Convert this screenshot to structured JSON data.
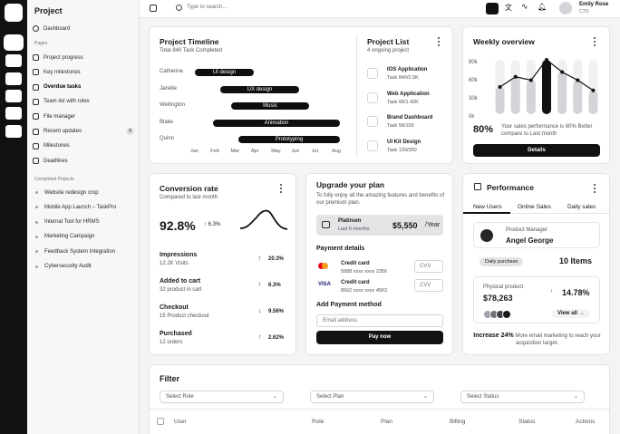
{
  "sidebar": {
    "title": "Project",
    "dashboard": "Dashboard",
    "pages_label": "Pages",
    "items": [
      {
        "label": "Project progress",
        "bold": false
      },
      {
        "label": "Key milestones",
        "bold": false
      },
      {
        "label": "Overdue tasks",
        "bold": true
      },
      {
        "label": "Team list with roles",
        "bold": false
      },
      {
        "label": "File manager",
        "bold": false
      },
      {
        "label": "Recent updates",
        "bold": false,
        "badge": "8"
      },
      {
        "label": "Milestones",
        "bold": false
      },
      {
        "label": "Deadlines",
        "bold": false
      }
    ],
    "completed_label": "Completed Projects",
    "completed": [
      "Website redesign crop",
      "Mobile App Launch – TaskPro",
      "Internal Tool for HRMS",
      "Marketing Campaign",
      "Feedback System Integration",
      "Cybersecurity Audit"
    ]
  },
  "topbar": {
    "search_placeholder": "Type to search...",
    "user_name": "Emily Rose",
    "user_role": "CTO"
  },
  "timeline": {
    "title": "Project Timeline",
    "subtitle": "Total 840 Task Completed",
    "rows": [
      {
        "name": "Catherine",
        "task": "UI design"
      },
      {
        "name": "Janelle",
        "task": "UX design"
      },
      {
        "name": "Wellington",
        "task": "Music"
      },
      {
        "name": "Blake",
        "task": "Animation"
      },
      {
        "name": "Quinn",
        "task": "Prototyping"
      }
    ],
    "months": [
      "Jan",
      "Feb",
      "Mar",
      "Apr",
      "May",
      "Jun",
      "Jul",
      "Aug"
    ]
  },
  "project_list": {
    "title": "Project List",
    "subtitle": "4 ongoing project",
    "items": [
      {
        "name": "IOS Application",
        "task": "Task 840/2.5K"
      },
      {
        "name": "Web Application",
        "task": "Task 99/1.42K"
      },
      {
        "name": "Brand Dashboard",
        "task": "Task 58/100"
      },
      {
        "name": "UI Kit Design",
        "task": "Task 120/350"
      }
    ]
  },
  "weekly": {
    "title": "Weekly overview",
    "ylabels": [
      "80k",
      "60k",
      "30k",
      "0k"
    ],
    "percent": "80%",
    "note": "Your sales performance is 60% Better compare to Last month",
    "button": "Details"
  },
  "chart_data": {
    "type": "bar",
    "values": [
      40,
      55,
      50,
      80,
      62,
      50,
      35
    ],
    "line": [
      40,
      55,
      50,
      80,
      62,
      50,
      35
    ],
    "ylim": [
      0,
      80
    ],
    "yticks": [
      "80k",
      "60k",
      "30k",
      "0k"
    ]
  },
  "conversion": {
    "title": "Conversion rate",
    "subtitle": "Compared to last month",
    "value": "92.8%",
    "change": "6.3%",
    "metrics": [
      {
        "label": "Impressions",
        "sub": "12.2K Visits",
        "value": "20.3%",
        "dir": "up"
      },
      {
        "label": "Added to cart",
        "sub": "32 product in cart",
        "value": "6.3%",
        "dir": "up"
      },
      {
        "label": "Checkout",
        "sub": "15 Product checkout",
        "value": "9.56%",
        "dir": "down"
      },
      {
        "label": "Purchased",
        "sub": "12 orders",
        "value": "2.62%",
        "dir": "up"
      }
    ]
  },
  "upgrade": {
    "title": "Upgrade your plan",
    "subtitle": "To fully enjoy all the amazing features and benefits of our premium plan.",
    "plan_name": "Platinum",
    "plan_period": "Last 6 months",
    "price": "$5,550",
    "price_unit": "/Year",
    "payment_details": "Payment details",
    "cards": [
      {
        "name": "Credit card",
        "number": "5888 xxxx xxxx 2356",
        "brand": "mc"
      },
      {
        "name": "Credit card",
        "number": "8562 xxxx xxxx 4563",
        "brand": "VISA"
      }
    ],
    "cvv_placeholder": "CVV",
    "add_method": "Add Payment method",
    "email_placeholder": "Email address",
    "button": "Pay now"
  },
  "performance": {
    "title": "Performance",
    "tabs": [
      "New Users",
      "Online Sales",
      "Daily sales"
    ],
    "manager_role": "Product Manager",
    "manager_name": "Angel George",
    "daily_label": "Daily purchase",
    "daily_value": "10 Items",
    "physical_label": "Physical product",
    "physical_value": "$78,263",
    "physical_change": "14.78%",
    "view_all": "View all",
    "increase_bold": "Increase 24%",
    "increase_text": "More email marketing to reach your acquisition target."
  },
  "filter": {
    "title": "Filter",
    "selects": [
      "Select Role",
      "Select Plan",
      "Select Status"
    ],
    "columns": [
      "User",
      "Role",
      "Plan",
      "Billing",
      "Status",
      "Actions"
    ]
  }
}
